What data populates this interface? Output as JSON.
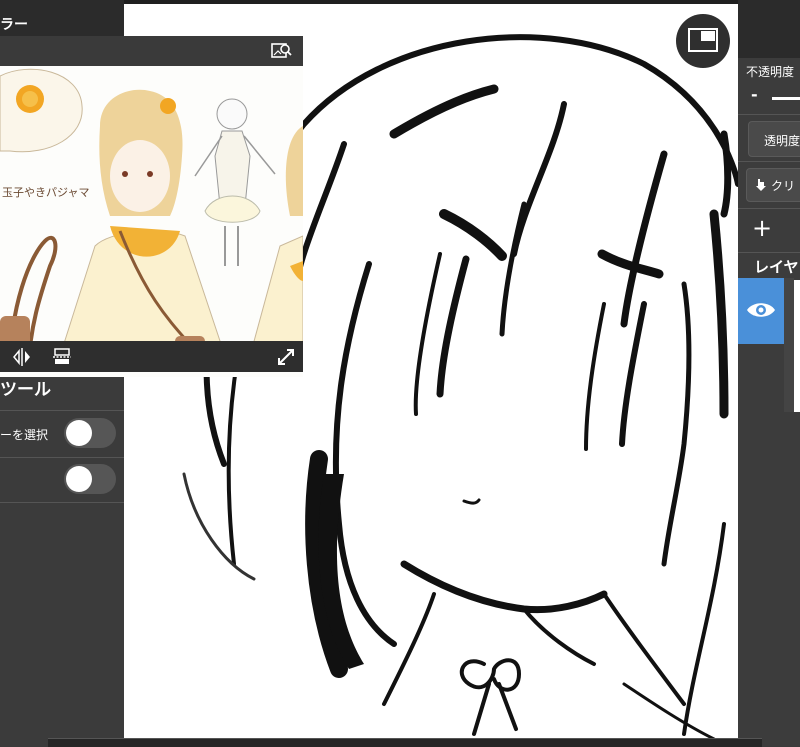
{
  "left_panel": {
    "header_fragment": "ラー",
    "tools_title": "ツール",
    "select_layer_label": "ーを選択",
    "toggles": [
      {
        "state": "off"
      },
      {
        "state": "off"
      }
    ]
  },
  "reference_window": {
    "image_caption": "玉子やきパジャマ"
  },
  "right_panel": {
    "opacity_label": "不透明度",
    "opacity_minus": "-",
    "transparency_button": "透明度",
    "clipping_button": "クリ",
    "add_symbol": "+",
    "layer_header": "レイヤ"
  },
  "colors": {
    "panel_bg": "#3b3b3b",
    "canvas_bg": "#ffffff",
    "accent_blue": "#4a90d9"
  },
  "icons": [
    "search-image-icon",
    "flip-horizontal-icon",
    "flip-vertical-icon",
    "resize-icon",
    "navigator-icon",
    "eye-icon",
    "clip-arrow-icon",
    "add-layer-icon"
  ]
}
